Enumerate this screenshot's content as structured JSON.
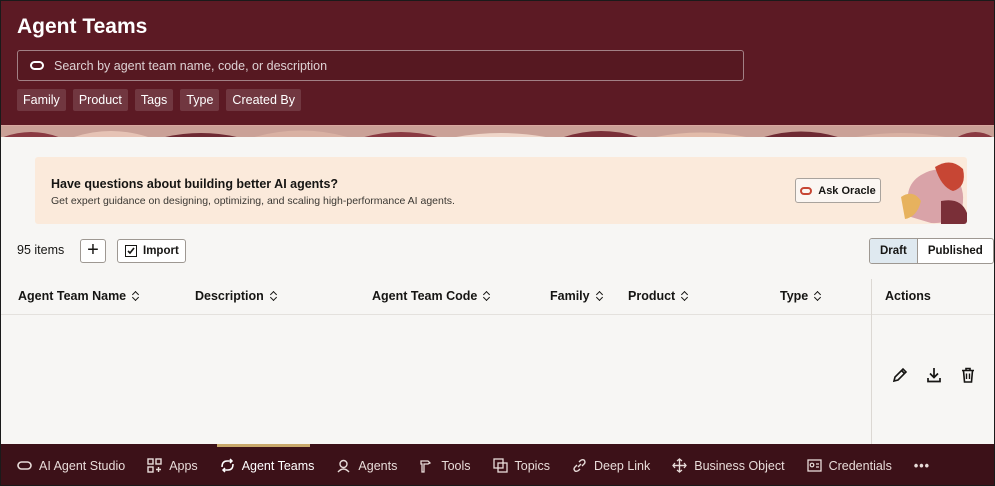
{
  "header": {
    "title": "Agent Teams",
    "search_placeholder": "Search by agent team name, code, or description",
    "filters": [
      "Family",
      "Product",
      "Tags",
      "Type",
      "Created By"
    ]
  },
  "banner": {
    "title": "Have questions about building better AI agents?",
    "subtitle": "Get expert guidance on designing, optimizing, and scaling high-performance AI agents.",
    "button_label": "Ask Oracle"
  },
  "toolbar": {
    "count": "95 items",
    "add_label": "+",
    "import_label": "Import",
    "segments": [
      "Draft",
      "Published"
    ],
    "active_segment": "Draft"
  },
  "table": {
    "columns": [
      "Agent Team Name",
      "Description",
      "Agent Team Code",
      "Family",
      "Product",
      "Type",
      "Actions"
    ]
  },
  "bottom_nav": {
    "items": [
      "AI Agent Studio",
      "Apps",
      "Agent Teams",
      "Agents",
      "Tools",
      "Topics",
      "Deep Link",
      "Business Object",
      "Credentials"
    ],
    "active": "Agent Teams",
    "more": "•••"
  },
  "colors": {
    "header": "#5c1a24",
    "bottom_nav": "#3c1118",
    "banner": "#fbeadb",
    "oracle_red": "#c74634",
    "active_segment": "#dfe9f0"
  }
}
